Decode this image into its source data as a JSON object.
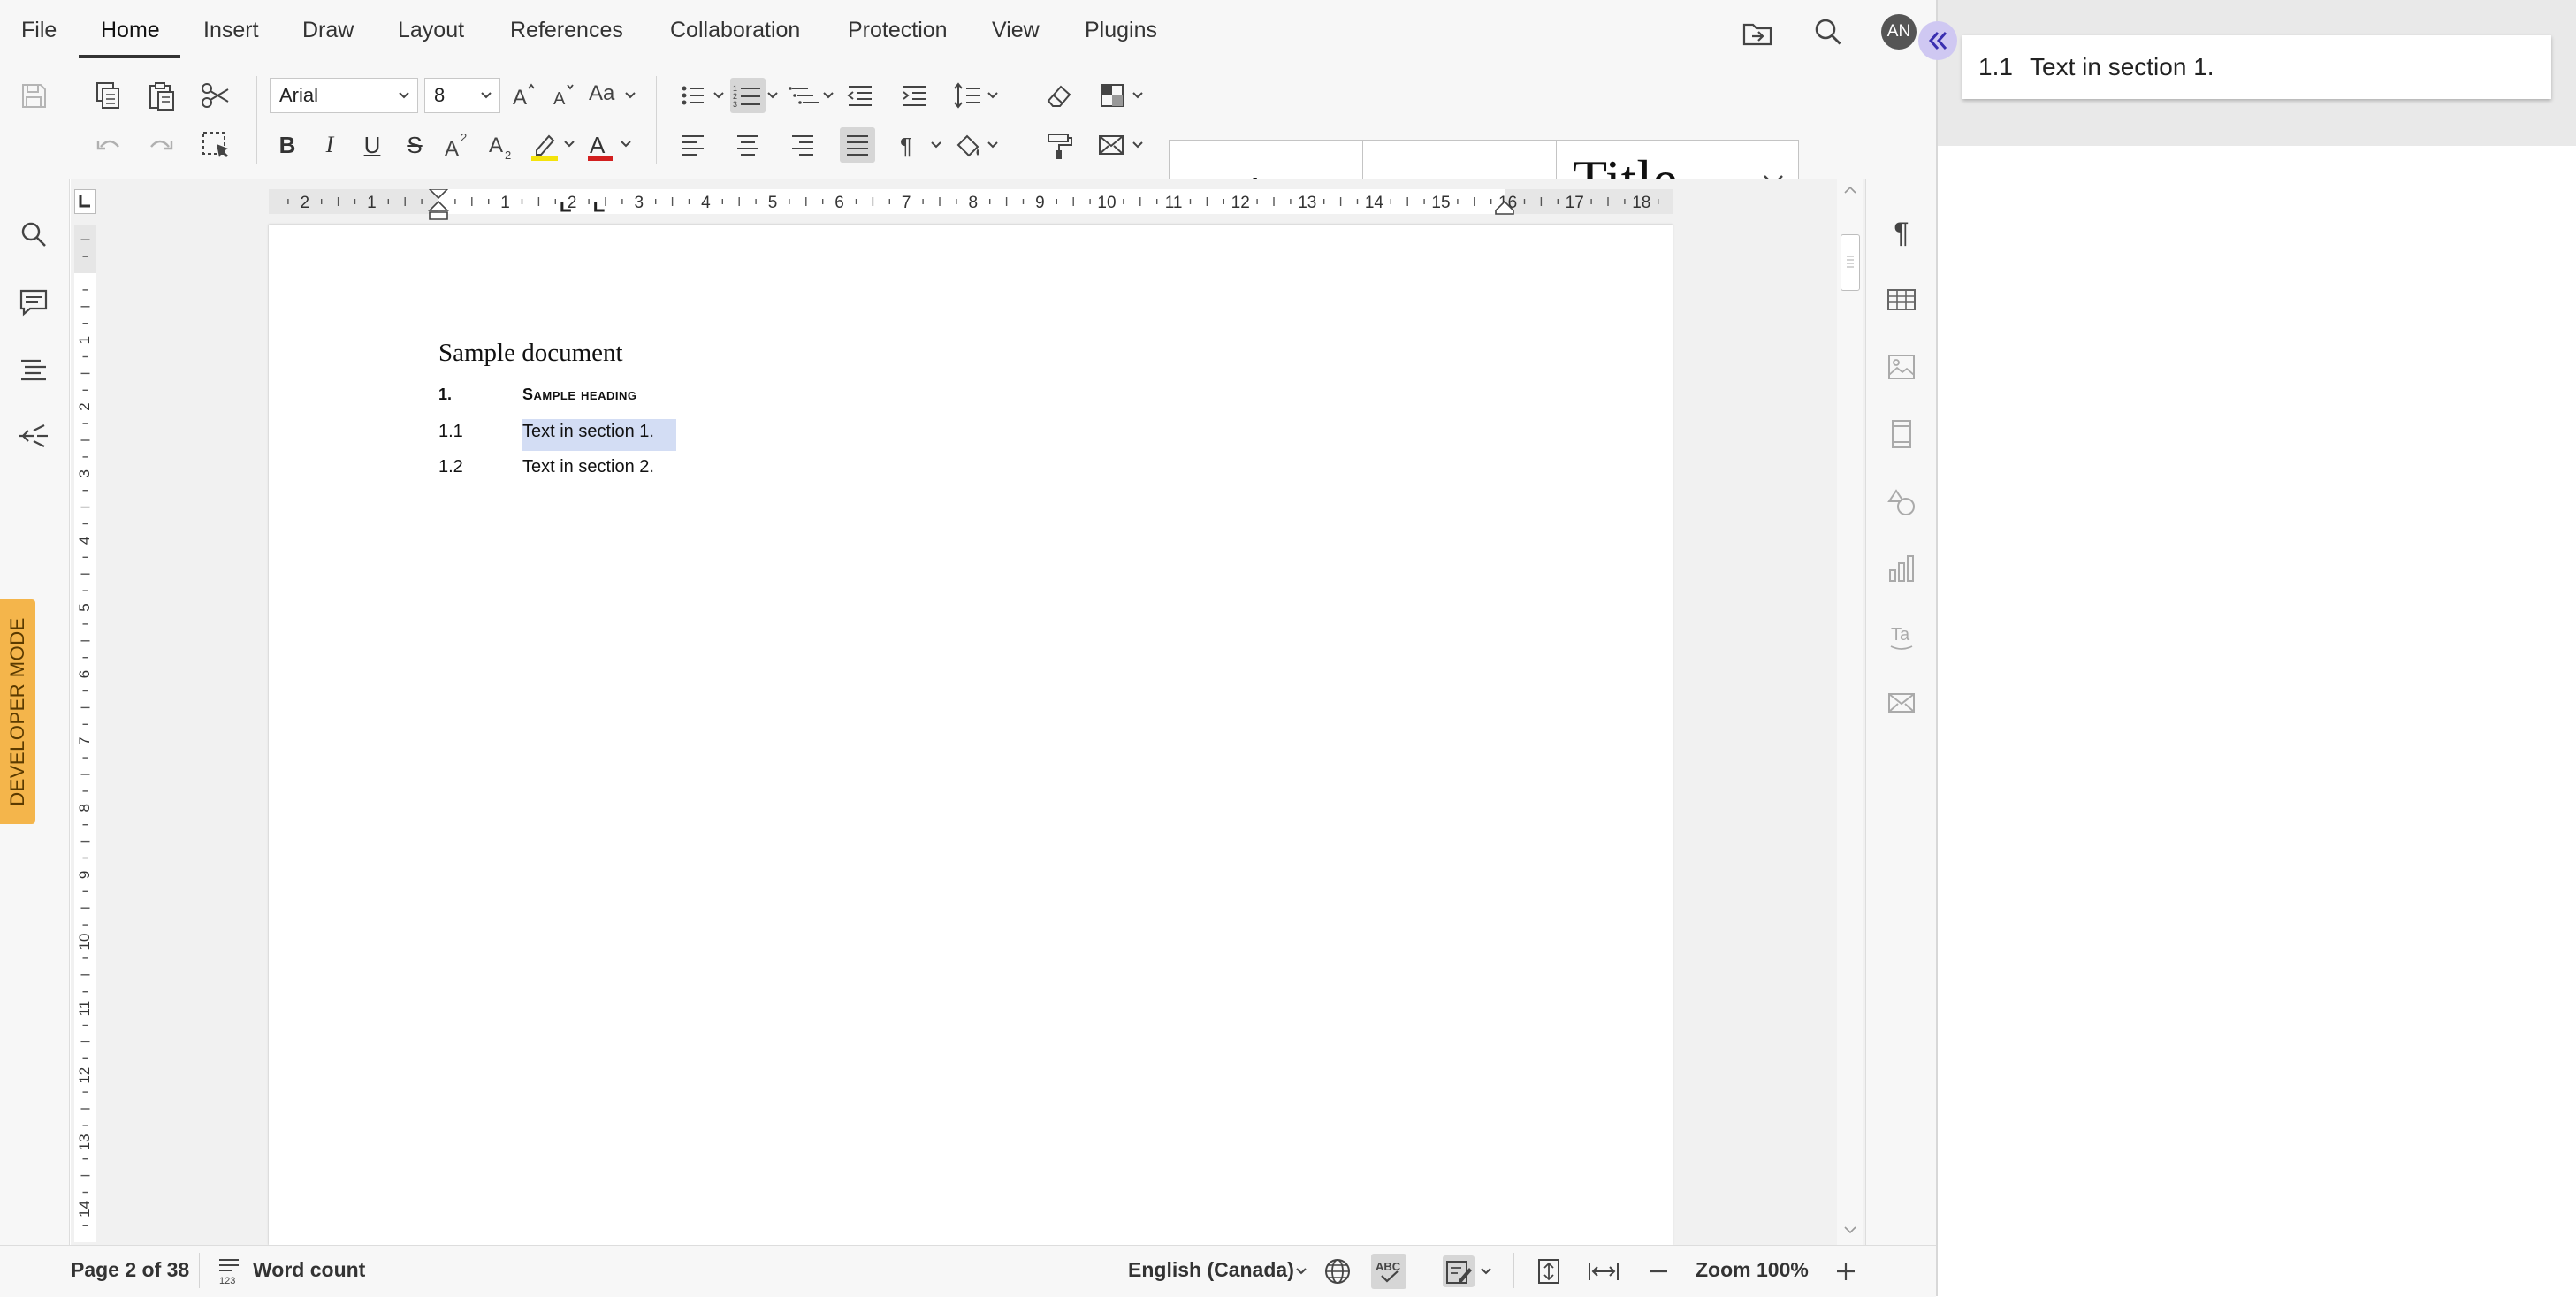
{
  "menu": {
    "items": [
      "File",
      "Home",
      "Insert",
      "Draw",
      "Layout",
      "References",
      "Collaboration",
      "Protection",
      "View",
      "Plugins"
    ],
    "active": "Home",
    "user_initials": "AN"
  },
  "toolbar": {
    "font_family": "Arial",
    "font_size": "8",
    "change_case_label": "Aa",
    "styles": [
      "Normal",
      "No Spacing",
      "Title"
    ]
  },
  "developer_mode_label": "DEVELOPER MODE",
  "ruler": {
    "horizontal_ticks": [
      "2",
      "1",
      "1",
      "2",
      "3",
      "4",
      "5",
      "6",
      "7",
      "8",
      "9",
      "10",
      "11",
      "12",
      "13",
      "14",
      "15",
      "16",
      "17",
      "18"
    ],
    "vertical_ticks": [
      "1",
      "2",
      "3",
      "4",
      "5",
      "6",
      "7",
      "8",
      "9",
      "10",
      "11",
      "12",
      "13",
      "14"
    ]
  },
  "document": {
    "title": "Sample document",
    "heading_number": "1.",
    "heading_text": "Sample heading",
    "items": [
      {
        "number": "1.1",
        "text": "Text in section 1."
      },
      {
        "number": "1.2",
        "text": "Text in section 2."
      }
    ]
  },
  "side_panel": {
    "item_number": "1.1",
    "item_text": "Text in section 1."
  },
  "status": {
    "page": "Page 2 of 38",
    "word_count": "Word count",
    "language": "English (Canada)",
    "zoom": "Zoom 100%"
  },
  "colors": {
    "accent": "#333333",
    "selection": "#d3ddf4",
    "developer_mode": "#f4b54b",
    "collapse_button": "#cfc8f2",
    "highlight": "#f4e30b",
    "font_color": "#d21f1f"
  }
}
